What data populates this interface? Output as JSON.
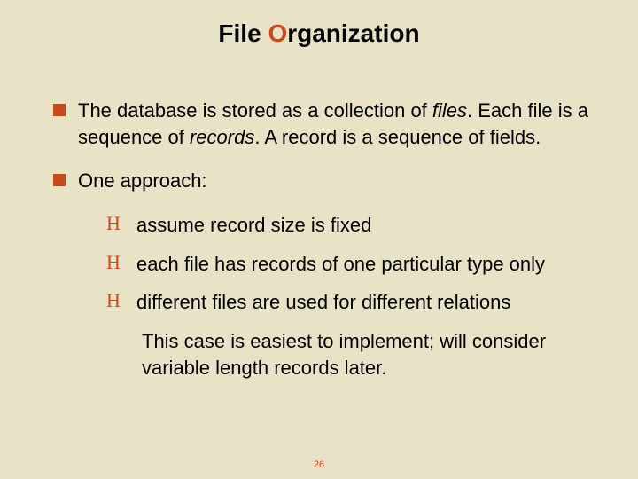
{
  "title_plain": "File ",
  "title_accent_first": "O",
  "title_rest": "rganization",
  "para1_pre": "The database is stored as a collection of ",
  "para1_it1": "files",
  "para1_mid1": ".  Each file is a sequence of ",
  "para1_it2": "records",
  "para1_mid2": ".  A record is a sequence of fields.",
  "para2": "One approach:",
  "sub1": "assume record size is fixed",
  "sub2": "each file has records of one particular type only",
  "sub3": "different files are used for different relations",
  "tail": "This case is easiest to implement; will consider variable length records later.",
  "page_number": "26",
  "script_mark": "H"
}
